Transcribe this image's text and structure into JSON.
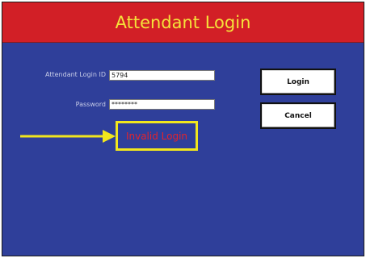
{
  "window": {
    "title": "Attendant Login"
  },
  "form": {
    "login_id_label": "Attendant Login ID",
    "login_id_value": "5794",
    "password_label": "Password",
    "password_value": "********"
  },
  "buttons": {
    "login_label": "Login",
    "cancel_label": "Cancel"
  },
  "error": {
    "message": "Invalid Login"
  },
  "annotation": {
    "arrow_icon": "arrow-right-icon",
    "arrow_color": "#f1e61d"
  },
  "colors": {
    "title_bar": "#d21f26",
    "title_text": "#f5e23a",
    "background": "#2f3f9a",
    "error_text": "#e4232b",
    "highlight": "#f1e61d"
  }
}
